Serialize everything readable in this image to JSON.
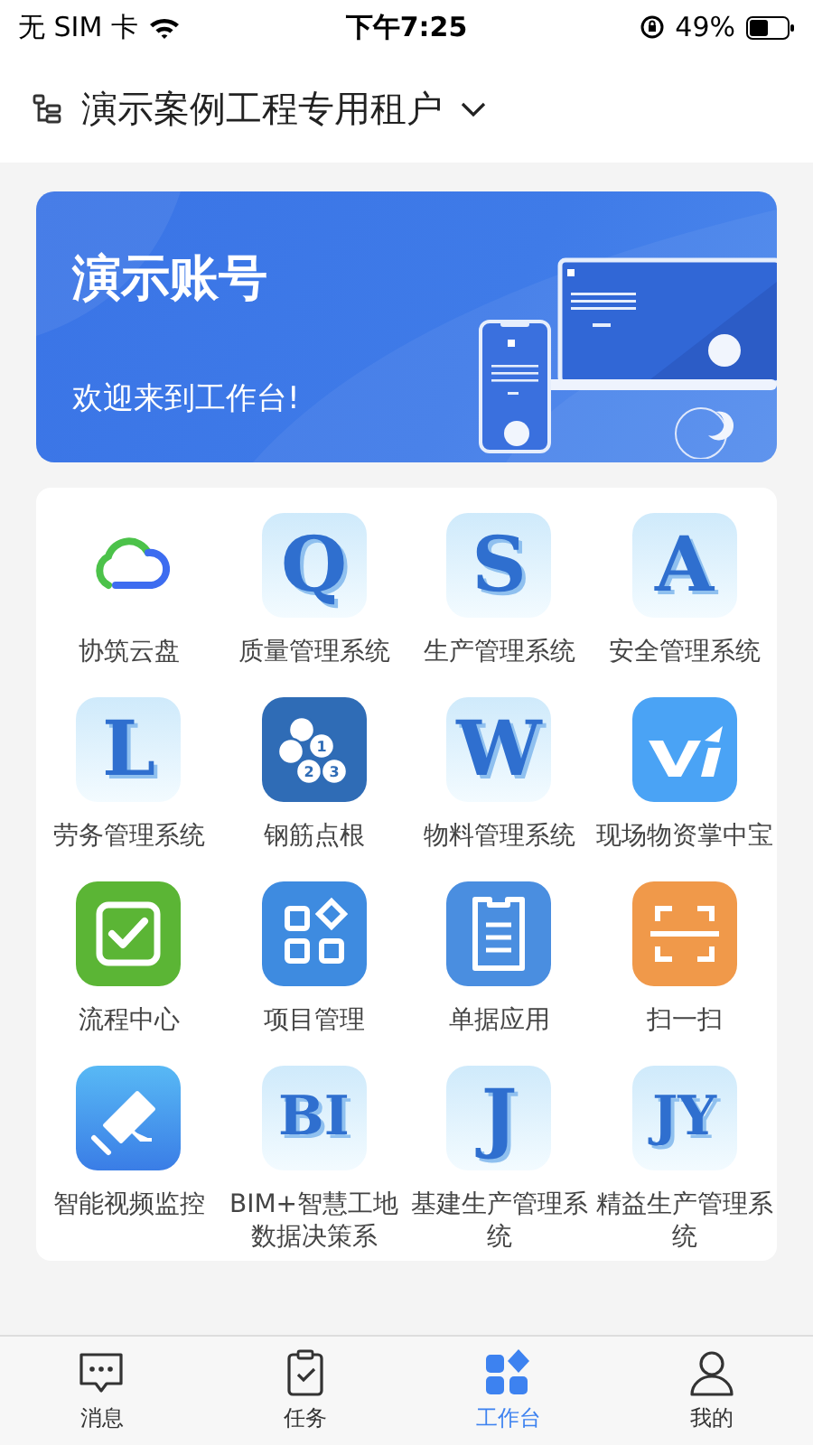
{
  "status_bar": {
    "carrier": "无 SIM 卡",
    "time": "下午7:25",
    "battery": "49%"
  },
  "header": {
    "title": "演示案例工程专用租户"
  },
  "banner": {
    "title": "演示账号",
    "subtitle": "欢迎来到工作台!"
  },
  "apps": [
    {
      "kind": "cloud",
      "label": "协筑云盘"
    },
    {
      "kind": "letter",
      "letter": "Q",
      "label": "质量管理系统"
    },
    {
      "kind": "letter",
      "letter": "S",
      "label": "生产管理系统"
    },
    {
      "kind": "letter",
      "letter": "A",
      "label": "安全管理系统"
    },
    {
      "kind": "letter",
      "letter": "L",
      "label": "劳务管理系统"
    },
    {
      "kind": "rebar",
      "marks": [
        "1",
        "2",
        "3"
      ],
      "label": "钢筋点根"
    },
    {
      "kind": "letter",
      "letter": "W",
      "label": "物料管理系统"
    },
    {
      "kind": "vj",
      "label": "现场物资掌中宝"
    },
    {
      "kind": "check",
      "label": "流程中心"
    },
    {
      "kind": "grid",
      "label": "项目管理"
    },
    {
      "kind": "form",
      "label": "单据应用"
    },
    {
      "kind": "scan",
      "label": "扫一扫"
    },
    {
      "kind": "camera",
      "label": "智能视频监控"
    },
    {
      "kind": "letter",
      "letter": "BI",
      "label": "BIM+智慧工地数据决策系"
    },
    {
      "kind": "letter",
      "letter": "J",
      "label": "基建生产管理系统"
    },
    {
      "kind": "letter",
      "letter": "JY",
      "label": "精益生产管理系统"
    }
  ],
  "tabs": [
    {
      "kind": "chat",
      "label": "消息",
      "selected": false
    },
    {
      "kind": "task",
      "label": "任务",
      "selected": false
    },
    {
      "kind": "desk",
      "label": "工作台",
      "selected": true
    },
    {
      "kind": "user",
      "label": "我的",
      "selected": false
    }
  ]
}
